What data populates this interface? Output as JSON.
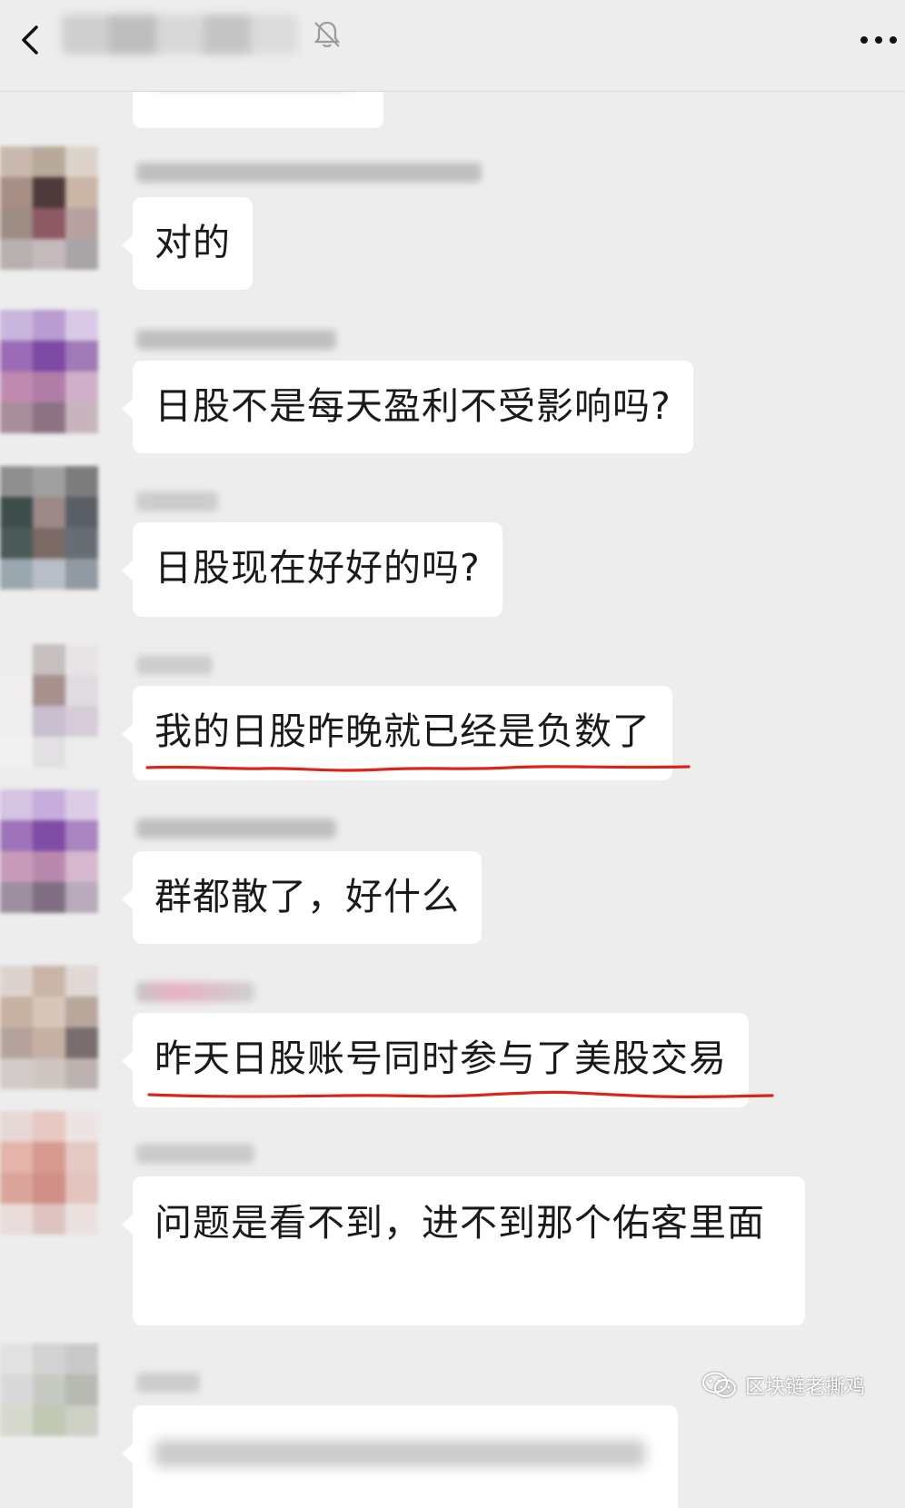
{
  "messages": [
    {
      "text": "对的"
    },
    {
      "text": "日股不是每天盈利不受影响吗?"
    },
    {
      "text": "日股现在好好的吗?"
    },
    {
      "text": "我的日股昨晚就已经是负数了"
    },
    {
      "text": "群都散了，好什么"
    },
    {
      "text": "昨天日股账号同时参与了美股交易"
    },
    {
      "text": "问题是看不到，进不到那个佑客里面"
    }
  ],
  "watermark": {
    "text": "区块链老撕鸡",
    "icon": "wechat-icon"
  },
  "header": {
    "icons": [
      "back-arrow-icon",
      "mute-bell-icon",
      "more-dots-icon"
    ]
  },
  "colors": {
    "background": "#ededed",
    "bubble": "#ffffff",
    "annotation": "#d8251b"
  }
}
